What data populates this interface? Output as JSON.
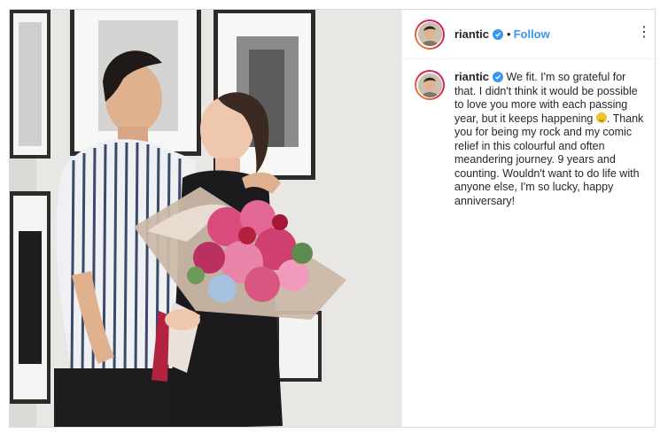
{
  "post": {
    "image_alt": "Couple embracing while holding a large bouquet of pink lilies",
    "icons": {
      "verified": "verified-badge-icon",
      "more": "more-options-icon",
      "emoji": "grinning-face-emoji"
    },
    "colors": {
      "accent": "#3897f0",
      "text": "#262626",
      "border": "#dbdbdb"
    }
  },
  "header": {
    "username": "riantic",
    "dot": "•",
    "follow_label": "Follow",
    "more_label": "⋮"
  },
  "caption": {
    "username": "riantic",
    "text_before_emoji": " We fit. I'm so grateful for that. I didn't think it would be possible to love you more with each passing year, but it keeps happening ",
    "text_after_emoji": ". Thank you for being my rock and my comic relief in this colourful and often meandering journey. 9 years and counting. Wouldn't want to do life with anyone else, I'm so lucky, happy anniversary!"
  }
}
